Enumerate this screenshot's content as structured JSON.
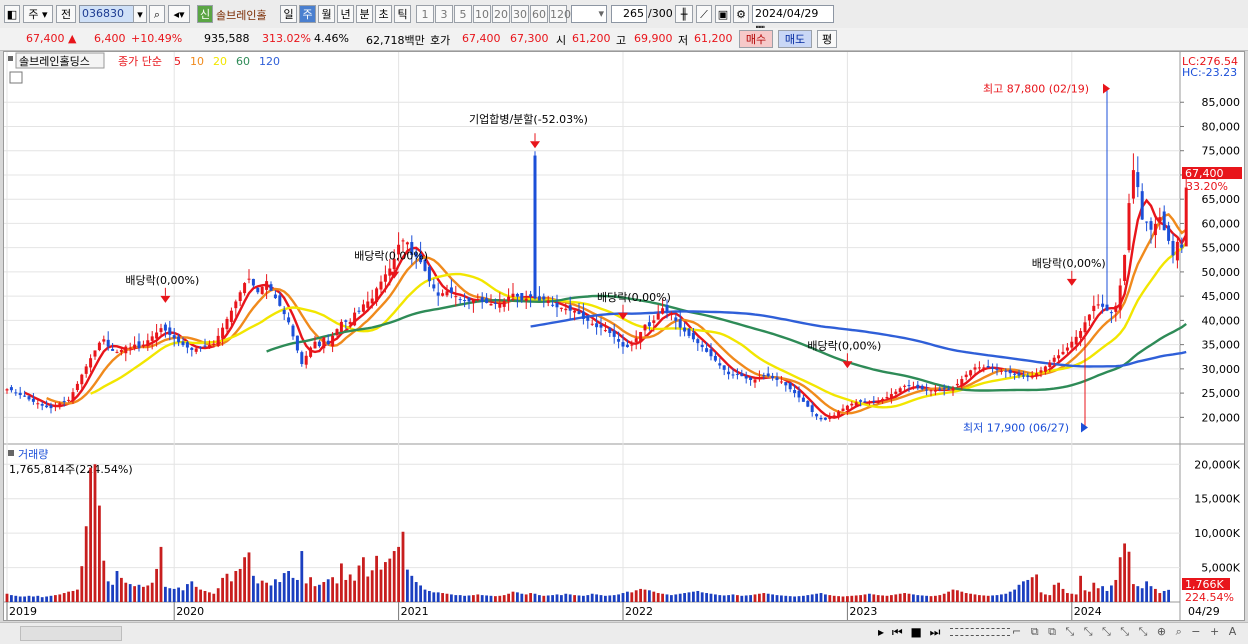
{
  "toolbar": {
    "period_main": "주",
    "prev_label": "전",
    "code": "036830",
    "stock_badge": "신",
    "stock_name": "솔브레인홀",
    "periods": [
      "일",
      "주",
      "월",
      "년",
      "분",
      "초",
      "틱"
    ],
    "selected_period": "주",
    "intervals": [
      "1",
      "3",
      "5",
      "10",
      "20",
      "30",
      "60",
      "120"
    ],
    "count": "265",
    "count_total": "/300",
    "date": "2024/04/29"
  },
  "quote": {
    "price": "67,400",
    "change": "6,400",
    "change_pct": "+10.49%",
    "volume": "935,588",
    "volume_ratio": "313.02%",
    "turnover": "4.46%",
    "amount": "62,718백만",
    "bid_label": "호가",
    "ask": "67,400",
    "bid": "67,300",
    "open_label": "시",
    "open": "61,200",
    "high_label": "고",
    "high": "69,900",
    "low_label": "저",
    "low": "61,200",
    "buy_label": "매수",
    "sell_label": "매도",
    "eval_label": "평"
  },
  "chart_data": {
    "type": "candlestick",
    "title": "솔브레인홀딩스",
    "ma_legend_label": "종가 단순",
    "ma_periods": [
      {
        "period": "5",
        "color": "#e8151b"
      },
      {
        "period": "10",
        "color": "#f08a1c"
      },
      {
        "period": "20",
        "color": "#f2e600"
      },
      {
        "period": "60",
        "color": "#2e8b57"
      },
      {
        "period": "120",
        "color": "#2f5fd8"
      }
    ],
    "lc": "LC:276.54",
    "hc": "HC:-23.23",
    "price_axis": {
      "ticks": [
        20000,
        25000,
        30000,
        35000,
        40000,
        45000,
        50000,
        55000,
        60000,
        65000,
        70000,
        75000,
        80000,
        85000
      ],
      "labels": [
        "20,000",
        "25,000",
        "30,000",
        "35,000",
        "40,000",
        "45,000",
        "50,000",
        "55,000",
        "60,000",
        "65,000",
        "70,000",
        "75,000",
        "80,000",
        "85,000"
      ],
      "ylim": [
        14500,
        90000
      ]
    },
    "current_price_label": "67,400",
    "current_pct_label": "33.20%",
    "years": [
      "2019",
      "2020",
      "2021",
      "2022",
      "2023",
      "2024"
    ],
    "last_date_label": "04/29",
    "annotations": [
      {
        "text": "기업합병/분할(-52.03%)"
      },
      {
        "text": "배당락(0,00%)"
      },
      {
        "text": "배당락(0,00%)"
      },
      {
        "text": "배당락(0,00%)"
      },
      {
        "text": "배당락(0,00%)"
      },
      {
        "text": "배당락(0,00%)"
      },
      {
        "text": "최고 87,800 (02/19)"
      },
      {
        "text": "최저 17,900 (06/27)"
      }
    ],
    "closes": [
      25800,
      25600,
      25000,
      24600,
      24400,
      23700,
      23200,
      22900,
      22400,
      22100,
      21900,
      22400,
      22900,
      23300,
      23600,
      25200,
      26900,
      28800,
      30500,
      32200,
      33800,
      35400,
      36100,
      34600,
      33700,
      33500,
      33900,
      34600,
      34400,
      35000,
      34300,
      35000,
      35900,
      36700,
      37500,
      38400,
      37900,
      37000,
      36300,
      35500,
      34900,
      34400,
      33900,
      34200,
      34400,
      34600,
      34900,
      35200,
      36800,
      38500,
      40300,
      42000,
      43900,
      45800,
      47700,
      48600,
      47200,
      45800,
      46900,
      48100,
      46100,
      44600,
      43000,
      41300,
      39600,
      36700,
      33800,
      31000,
      32700,
      34400,
      35600,
      34700,
      36500,
      35100,
      36800,
      38200,
      39700,
      39700,
      39700,
      41600,
      41900,
      43300,
      43900,
      44500,
      46600,
      48000,
      49500,
      50700,
      52700,
      55600,
      56500,
      56100,
      53500,
      53100,
      52000,
      50200,
      48100,
      46600,
      45100,
      45600,
      46000,
      45700,
      45000,
      44200,
      44000,
      43900,
      44200,
      44400,
      43800,
      43600,
      43400,
      43400,
      43600,
      44000,
      44900,
      45500,
      44900,
      44200,
      44500,
      44900,
      44500,
      44100,
      44300,
      44100,
      43200,
      42700,
      42600,
      42400,
      42000,
      42000,
      41300,
      40300,
      39900,
      39300,
      38600,
      38500,
      38000,
      37400,
      36600,
      35600,
      34600,
      34500,
      35000,
      36300,
      37600,
      39100,
      38800,
      40000,
      41400,
      42500,
      41900,
      41300,
      39900,
      38500,
      37700,
      36800,
      36100,
      35300,
      34500,
      33500,
      32600,
      31700,
      30700,
      29800,
      28900,
      28700,
      28800,
      28500,
      28000,
      27700,
      27800,
      28300,
      28700,
      28500,
      28100,
      27700,
      27400,
      26600,
      25800,
      25000,
      24100,
      23200,
      22200,
      21100,
      20200,
      19600,
      19500,
      20000,
      20400,
      21200,
      21800,
      22400,
      22800,
      23100,
      23200,
      23200,
      23100,
      23300,
      23400,
      23800,
      24200,
      24800,
      25300,
      26000,
      26500,
      26500,
      26300,
      26000,
      25800,
      25600,
      25600,
      25600,
      25700,
      25800,
      25800,
      26100,
      26900,
      27900,
      28800,
      29700,
      30300,
      30300,
      30300,
      30300,
      30000,
      29900,
      29600,
      29400,
      29100,
      28800,
      28600,
      28400,
      28300,
      28600,
      29100,
      29700,
      30500,
      31300,
      32300,
      32800,
      33500,
      34400,
      35600,
      36600,
      37800,
      39600,
      41200,
      43000,
      43300,
      42800,
      42000,
      41500,
      43000,
      47200,
      53500,
      64200,
      71000,
      67500,
      60800,
      60200,
      58700,
      59900,
      61300,
      58600,
      56400,
      53400,
      56200,
      55000,
      67400
    ],
    "volumes_k": [
      1200,
      1000,
      900,
      800,
      800,
      900,
      800,
      900,
      700,
      800,
      900,
      1000,
      1100,
      1300,
      1500,
      1600,
      1800,
      5200,
      11000,
      19500,
      20000,
      14000,
      6000,
      3000,
      2500,
      4500,
      3500,
      2800,
      2600,
      2300,
      2500,
      2200,
      2400,
      2800,
      4800,
      8000,
      2200,
      2000,
      1900,
      2100,
      1700,
      2600,
      3000,
      2200,
      1800,
      1600,
      1400,
      1200,
      2000,
      3500,
      4100,
      3000,
      4500,
      4800,
      6500,
      7200,
      3800,
      2700,
      3100,
      2800,
      2400,
      3300,
      2900,
      4200,
      4500,
      3500,
      3200,
      7400,
      2700,
      3600,
      2300,
      2500,
      2900,
      3300,
      3600,
      2700,
      5600,
      3200,
      4000,
      3100,
      5300,
      6500,
      3700,
      4600,
      6700,
      4700,
      5800,
      6300,
      7400,
      8000,
      10200,
      4700,
      3800,
      2900,
      2400,
      1800,
      1600,
      1400,
      1400,
      1300,
      1200,
      1100,
      1000,
      1000,
      900,
      950,
      1000,
      1100,
      1000,
      950,
      900,
      850,
      900,
      1000,
      1200,
      1500,
      1400,
      1200,
      1100,
      1300,
      1200,
      1000,
      900,
      950,
      1000,
      1100,
      1000,
      1200,
      1100,
      1000,
      950,
      900,
      1000,
      1200,
      1100,
      1000,
      900,
      950,
      1000,
      1100,
      1300,
      1500,
      1400,
      1700,
      1900,
      1800,
      1700,
      1500,
      1300,
      1200,
      1100,
      1000,
      1100,
      1200,
      1300,
      1400,
      1500,
      1600,
      1400,
      1300,
      1200,
      1100,
      1000,
      950,
      1000,
      1100,
      1000,
      900,
      950,
      1000,
      1100,
      1200,
      1300,
      1200,
      1100,
      1000,
      950,
      900,
      850,
      800,
      850,
      900,
      1000,
      1100,
      1200,
      1300,
      1100,
      1000,
      900,
      850,
      800,
      850,
      900,
      950,
      1000,
      1100,
      1200,
      1100,
      1000,
      950,
      900,
      1000,
      1100,
      1200,
      1300,
      1200,
      1100,
      1000,
      950,
      900,
      850,
      900,
      1000,
      1200,
      1500,
      1800,
      1700,
      1500,
      1300,
      1200,
      1100,
      1000,
      950,
      900,
      950,
      1000,
      1100,
      1200,
      1500,
      1800,
      2500,
      3000,
      3200,
      3600,
      4000,
      1400,
      1100,
      1000,
      2500,
      2800,
      1900,
      1300,
      1200,
      1100,
      3800,
      1700,
      1500,
      2800,
      2000,
      2300,
      1600,
      2400,
      3200,
      6500,
      8500,
      7300,
      2600,
      2300,
      2000,
      3000,
      2300,
      1900,
      1300,
      1600,
      1766
    ],
    "volume_axis": {
      "ticks": [
        5000,
        10000,
        15000,
        20000
      ],
      "labels": [
        "5,000K",
        "10,000K",
        "15,000K",
        "20,000K"
      ],
      "ylim": [
        0,
        21200
      ]
    },
    "volume_title": "거래량",
    "volume_info": "1,765,814주(224.54%)",
    "volume_last_label": "1,766K",
    "volume_last_pct": "224.54%"
  },
  "colors": {
    "up": "#e8151b",
    "down": "#1b4fd8",
    "volume_up": "#c81e1e",
    "volume_down": "#1b3fc0",
    "ma5": "#e8151b",
    "ma10": "#f08a1c",
    "ma20": "#f2e600",
    "ma60": "#2e8b57",
    "ma120": "#2f5fd8"
  }
}
